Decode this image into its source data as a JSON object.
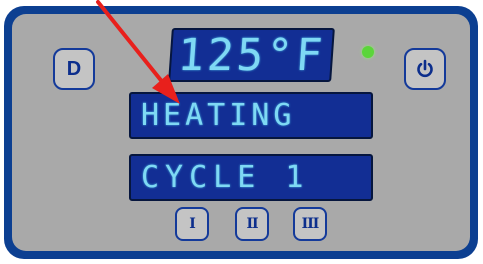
{
  "controller": {
    "temperature_display": "125°F",
    "status_display": "HEATING",
    "cycle_display": "CYCLE 1",
    "led_color": "#5bd53a",
    "buttons": {
      "d_label": "D",
      "cycle_1_label": "I",
      "cycle_2_label": "II",
      "cycle_3_label": "III",
      "power_icon": "power-icon"
    }
  },
  "annotation": {
    "arrow_color": "#e8201c",
    "arrow_target": "status-display"
  },
  "colors": {
    "bezel": "#0c3f91",
    "panel": "#a9a9a9",
    "lcd_background": "#122e94",
    "lcd_text": "#7fd9f4"
  }
}
